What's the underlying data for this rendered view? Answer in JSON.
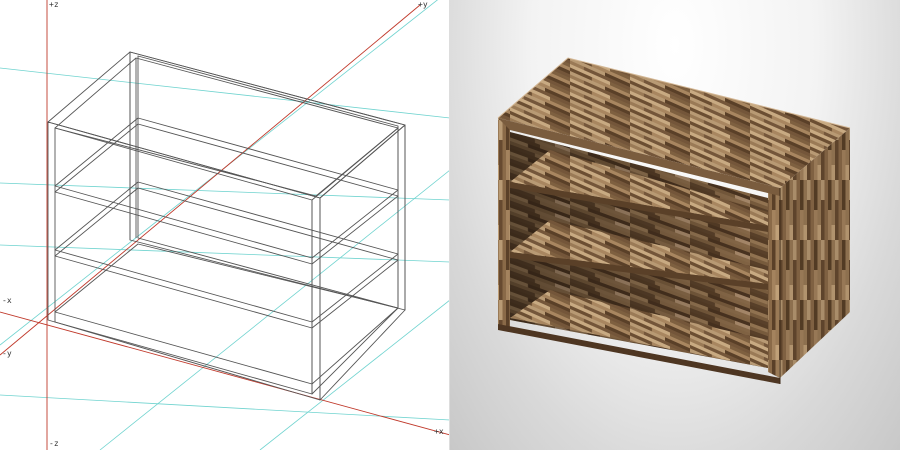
{
  "wireframe_view": {
    "axis_labels": {
      "top_z": "+z",
      "top_y": "+y",
      "left_x": "-x",
      "left_y": "-y",
      "bottom_z": "-z",
      "bottom_x": "+x"
    },
    "colors": {
      "background": "#ffffff",
      "axis_primary": "#c0392b",
      "grid_secondary": "#6fd3cf",
      "wire": "#555555"
    }
  },
  "render_view": {
    "object": "open-shelf-cabinet",
    "material": "mixed-wood-strips",
    "colors": {
      "wood_dark": "#5a4028",
      "wood_mid": "#8a6a48",
      "wood_light": "#b89a74"
    }
  }
}
